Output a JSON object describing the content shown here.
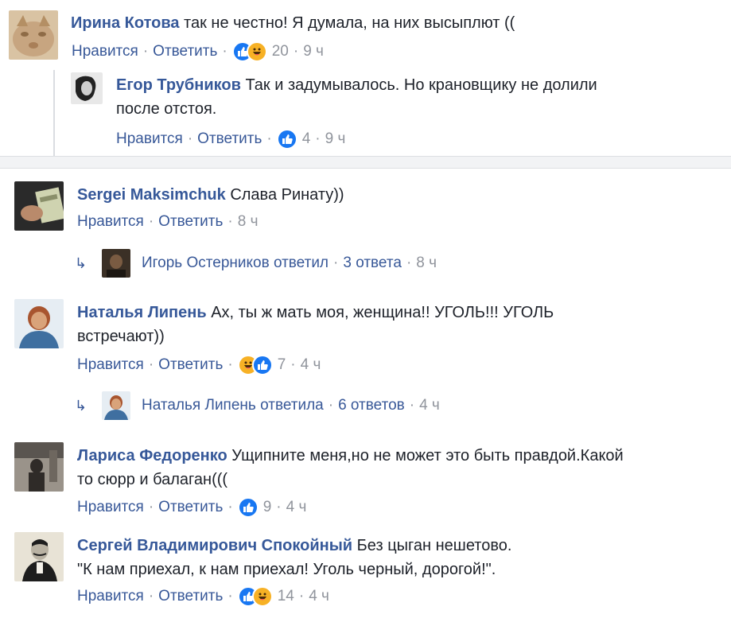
{
  "ui": {
    "like_label": "Нравится",
    "reply_label": "Ответить",
    "separator": "·"
  },
  "comments": [
    {
      "author": "Ирина Котова",
      "text": "так не честно! Я думала, на них высыплют ((",
      "reactions": [
        "like",
        "haha"
      ],
      "reaction_count": "20",
      "time": "9 ч",
      "avatar_colors": [
        "#c7a580",
        "#8e6b46",
        "#d9c3a3"
      ]
    },
    {
      "author": "Егор Трубников",
      "text_lines": [
        "Так и задумывалось. Но крановщику не долили",
        "после отстоя."
      ],
      "reactions": [
        "like"
      ],
      "reaction_count": "4",
      "time": "9 ч",
      "avatar_colors": [
        "#222222",
        "#e8e8e8"
      ]
    },
    {
      "author": "Sergei Maksimchuk",
      "text": "Слава Ринату))",
      "time": "8 ч",
      "replies_summary": {
        "who": "Игорь Остерников ответил",
        "count": "3 ответа",
        "time": "8 ч"
      },
      "avatar_colors": [
        "#2a2a2a",
        "#cfd3b0",
        "#8a8f6a"
      ]
    },
    {
      "author": "Наталья Липень",
      "text_lines": [
        "Ах, ты ж мать моя, женщина!! УГОЛЬ!!! УГОЛЬ",
        "встречают))"
      ],
      "reactions": [
        "haha",
        "like"
      ],
      "reaction_count": "7",
      "time": "4 ч",
      "replies_summary": {
        "who": "Наталья Липень ответила",
        "count": "6 ответов",
        "time": "4 ч"
      },
      "avatar_colors": [
        "#3f6fa0",
        "#d9a37a",
        "#a8552f"
      ]
    },
    {
      "author": "Лариса Федоренко",
      "text_lines": [
        "Ущипните меня,но не может это быть правдой.Какой",
        "то сюрр и балаган((("
      ],
      "reactions": [
        "like"
      ],
      "reaction_count": "9",
      "time": "4 ч",
      "avatar_colors": [
        "#5a5550",
        "#9a938a",
        "#2f2b28"
      ]
    },
    {
      "author": "Сергей Владимирович Спокойный",
      "text_lines": [
        "Без цыган нешетово.",
        "\"К нам приехал, к нам приехал! Уголь черный, дорогой!\"."
      ],
      "reactions": [
        "like",
        "haha"
      ],
      "reaction_count": "14",
      "time": "4 ч",
      "avatar_colors": [
        "#e8e3d6",
        "#1e1e1e",
        "#b9b2a3"
      ]
    }
  ]
}
